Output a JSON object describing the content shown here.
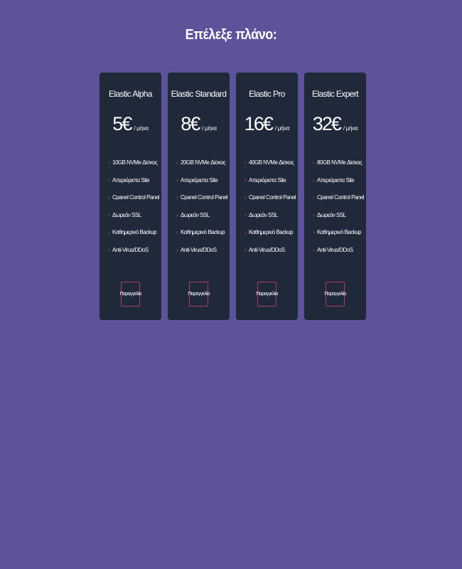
{
  "page": {
    "title": "Επέλεξε πλάνο:"
  },
  "theme": {
    "background": "#5c539b",
    "card": "#1f293a",
    "accent": "#d24a6e"
  },
  "plans": [
    {
      "name": "Elastic Alpha",
      "price": "5€",
      "period": "/ μήνα",
      "features": [
        "10GB NVMe Δίσκος",
        "Απεριόριστα Site",
        "Cpanel Control Panel",
        "Δωρεάν SSL",
        "Καθημερινό Backup",
        "Anti-Virus/DDoS"
      ],
      "button": "Παραγγελία"
    },
    {
      "name": "Elastic Standard",
      "price": "8€",
      "period": "/ μήνα",
      "features": [
        "20GB NVMe Δίσκος",
        "Απεριόριστα Site",
        "Cpanel Control Panel",
        "Δωρεάν SSL",
        "Καθημερινό Backup",
        "Anti-Virus/DDoS"
      ],
      "button": "Παραγγελία"
    },
    {
      "name": "Elastic Pro",
      "price": "16€",
      "period": "/ μήνα",
      "features": [
        "40GB NVMe Δίσκος",
        "Απεριόριστα Site",
        "Cpanel Control Panel",
        "Δωρεάν SSL",
        "Καθημερινό Backup",
        "Anti-Virus/DDoS"
      ],
      "button": "Παραγγελία"
    },
    {
      "name": "Elastic Expert",
      "price": "32€",
      "period": "/ μήνα",
      "features": [
        "80GB NVMe Δίσκος",
        "Απεριόριστα Site",
        "Cpanel Control Panel",
        "Δωρεάν SSL",
        "Καθημερινό Backup",
        "Anti-Virus/DDoS"
      ],
      "button": "Παραγγελία"
    }
  ],
  "icons": {
    "feature_bullet": "chevron-right-icon"
  }
}
